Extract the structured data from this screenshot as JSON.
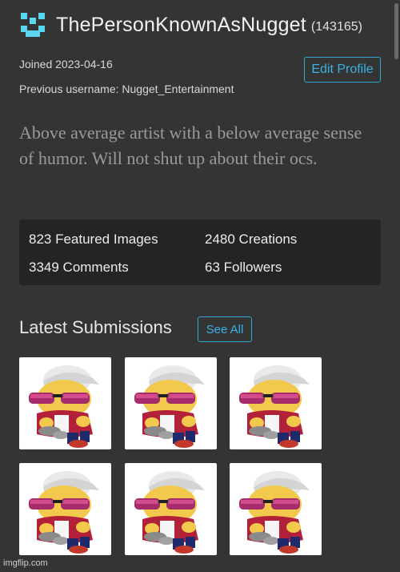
{
  "profile": {
    "username": "ThePersonKnownAsNugget",
    "user_id": "(143165)",
    "joined": "Joined 2023-04-16",
    "previous_username": "Previous username: Nugget_Entertainment",
    "edit_label": "Edit Profile",
    "bio": "Above average artist with a below average sense of humor. Will not shut up about their ocs.",
    "avatar_color": "#5bd6f0"
  },
  "stats": {
    "featured": "823 Featured Images",
    "creations": "2480 Creations",
    "comments": "3349 Comments",
    "followers": "63 Followers"
  },
  "latest": {
    "title": "Latest Submissions",
    "see_all_label": "See All"
  },
  "thumbnails_count": 6,
  "watermark": "imgflip.com",
  "colors": {
    "background": "#343434",
    "stats_panel": "#242424",
    "accent": "#3ab3e3"
  }
}
